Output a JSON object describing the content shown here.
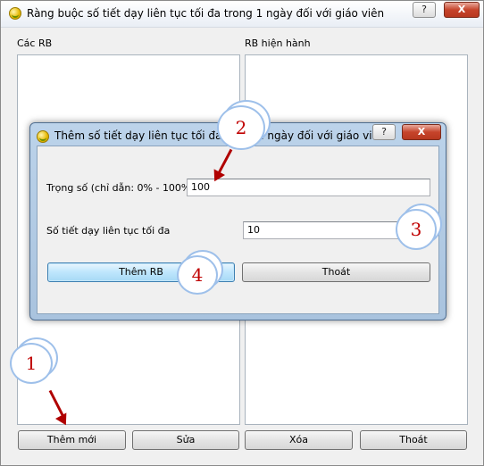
{
  "main_window": {
    "title": "Ràng buộc số tiết dạy liên tục tối đa trong 1 ngày đối với giáo viên",
    "help_button": "?",
    "close_button": "X",
    "left_list_label": "Các RB",
    "right_list_label": "RB hiện hành",
    "buttons": {
      "add": "Thêm mới",
      "edit": "Sửa",
      "delete": "Xóa",
      "exit": "Thoát"
    }
  },
  "dialog": {
    "title": "Thêm số tiết dạy liên tục tối đa trong 1 ngày đối với giáo viên",
    "help_button": "?",
    "close_button": "X",
    "weight_label": "Trọng số (chỉ dẫn: 0% - 100%)",
    "weight_value": "100",
    "max_label": "Số tiết dạy liên tục tối đa",
    "max_value": "10",
    "add_button": "Thêm RB",
    "exit_button": "Thoát"
  },
  "callouts": [
    "1",
    "2",
    "3",
    "4"
  ],
  "colors": {
    "callout_number": "#c00000",
    "arrow": "#b00000",
    "cloud_border": "#9ec0ea"
  }
}
